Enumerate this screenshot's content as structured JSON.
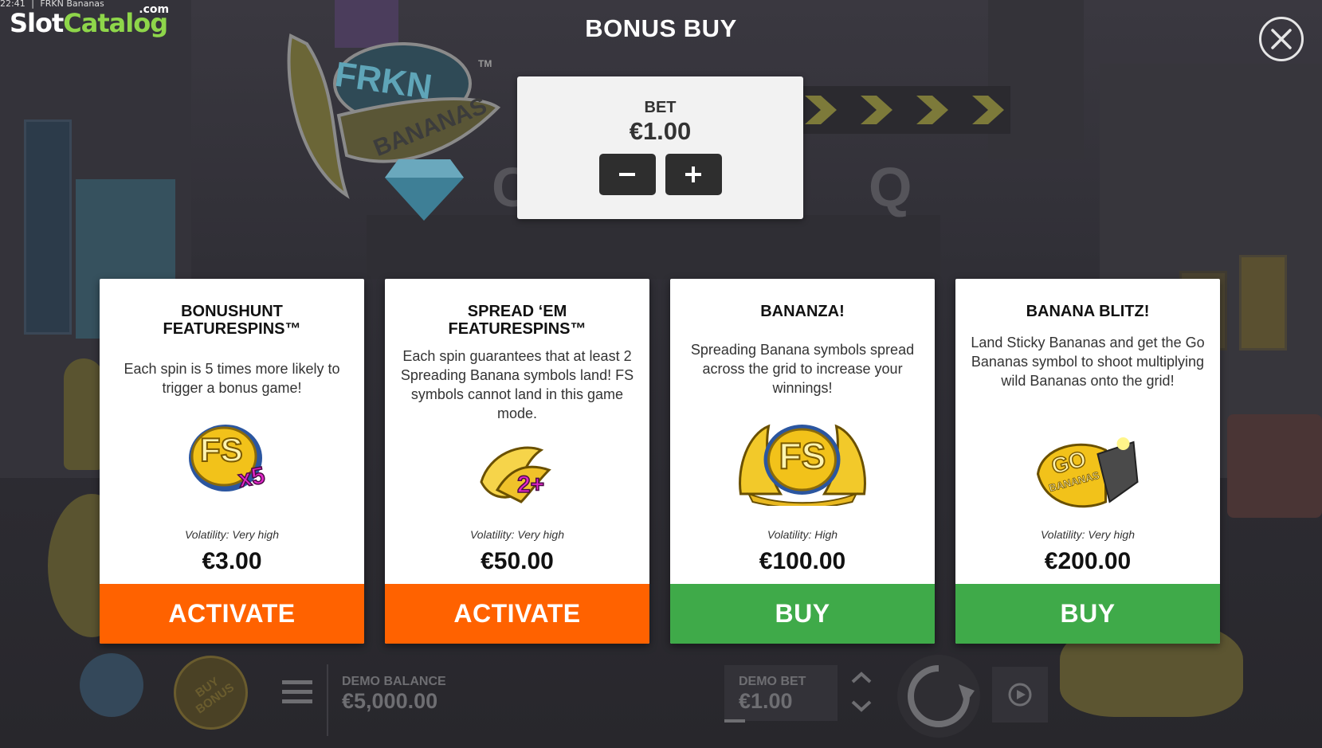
{
  "window": {
    "clock": "22:41",
    "title": "FRKN Bananas"
  },
  "watermark": {
    "part1": "Slot",
    "part2": "Catalog",
    "suffix": ".com"
  },
  "game_logo": {
    "line1": "FRKN",
    "line2": "BANANAS",
    "trademark": "TM"
  },
  "modal": {
    "title": "BONUS BUY",
    "close_icon": "close-icon"
  },
  "bet": {
    "label": "BET",
    "value": "€1.00",
    "decrease_icon": "minus-icon",
    "increase_icon": "plus-icon"
  },
  "cards": [
    {
      "title": "BONUSHUNT FEATURESPINS™",
      "description": "Each spin is 5 times more likely to trigger a bonus game!",
      "icon": "fs-x5-icon",
      "icon_text": "FS",
      "icon_sub": "x5",
      "volatility": "Volatility: Very high",
      "price": "€3.00",
      "action": "ACTIVATE",
      "action_color": "#ff6200"
    },
    {
      "title": "SPREAD ‘EM FEATURESPINS™",
      "description": "Each spin guarantees that at least 2 Spreading Banana symbols land! FS symbols cannot land in this game mode.",
      "icon": "banana-2plus-icon",
      "icon_sub": "2+",
      "volatility": "Volatility: Very high",
      "price": "€50.00",
      "action": "ACTIVATE",
      "action_color": "#ff6200"
    },
    {
      "title": "BANANZA!",
      "description": "Spreading Banana symbols spread across the grid to increase your winnings!",
      "icon": "fs-bananas-icon",
      "icon_text": "FS",
      "volatility": "Volatility: High",
      "price": "€100.00",
      "action": "BUY",
      "action_color": "#3faa49"
    },
    {
      "title": "BANANA BLITZ!",
      "description": "Land Sticky Bananas and get the Go Bananas symbol to shoot multiplying wild Bananas onto the grid!",
      "icon": "go-bananas-icon",
      "icon_text": "GO",
      "icon_sub": "BANANAS",
      "volatility": "Volatility: Very high",
      "price": "€200.00",
      "action": "BUY",
      "action_color": "#3faa49"
    }
  ],
  "bottom_bar": {
    "buy_bonus_label": "BUY BONUS",
    "menu_icon": "hamburger-menu-icon",
    "balance_label": "DEMO BALANCE",
    "balance_value": "€5,000.00",
    "bet_label": "DEMO BET",
    "bet_value": "€1.00",
    "bet_up_icon": "chevron-up-icon",
    "bet_down_icon": "chevron-down-icon",
    "spin_icon": "spin-icon",
    "autoplay_icon": "autoplay-icon"
  },
  "background_symbols": {
    "reel_q": "Q",
    "reel_c": "C"
  },
  "colors": {
    "activate": "#ff6200",
    "buy": "#3faa49",
    "watermark_green": "#8ed64a"
  }
}
